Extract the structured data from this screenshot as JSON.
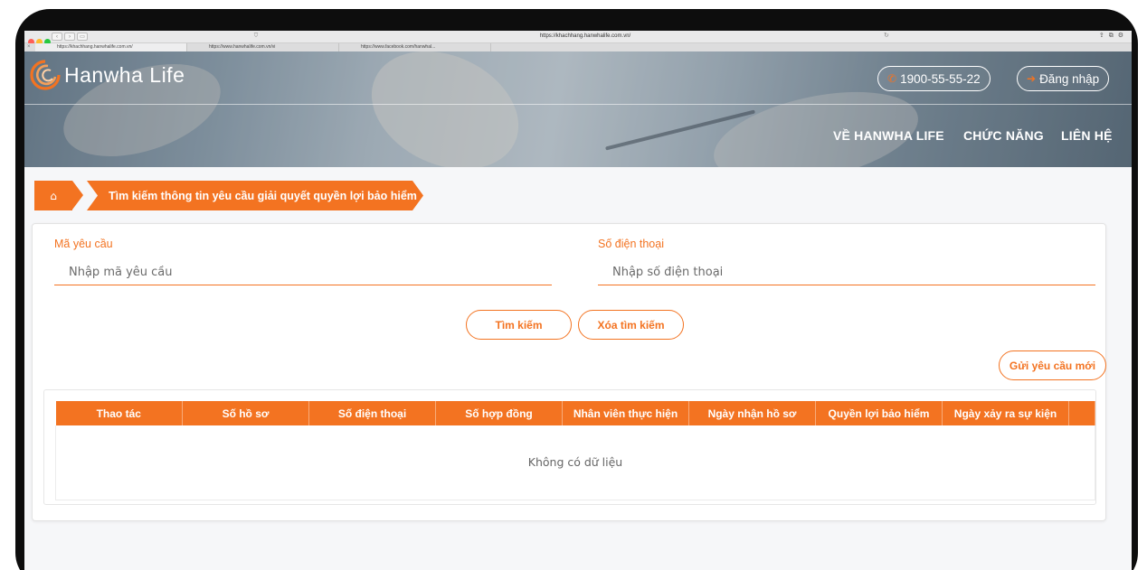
{
  "browser": {
    "address": "https://khachhang.hanwhalife.com.vn/",
    "tabs": [
      {
        "label": "https://khachhang.hanwhalife.com.vn/"
      },
      {
        "label": "https://www.hanwhalife.com.vn/vi"
      },
      {
        "label": "https://www.facebook.com/hanwhal..."
      }
    ]
  },
  "header": {
    "logo_text": "Hanwha Life",
    "hotline": "1900-55-55-22",
    "login_label": "Đăng nhập",
    "menu": [
      {
        "label": "VỀ HANWHA LIFE"
      },
      {
        "label": "CHỨC NĂNG"
      },
      {
        "label": "LIÊN HỆ"
      }
    ]
  },
  "breadcrumb": {
    "title": "Tìm kiếm thông tin yêu cầu giải quyết quyền lợi bảo hiểm"
  },
  "search": {
    "request_code_label": "Mã yêu cầu",
    "request_code_placeholder": "Nhập mã yêu cầu",
    "phone_label": "Số điện thoại",
    "phone_placeholder": "Nhập số điện thoại",
    "search_button": "Tìm kiếm",
    "clear_button": "Xóa tìm kiếm",
    "new_request_button": "Gửi yêu cầu mới"
  },
  "table": {
    "columns": [
      "Thao tác",
      "Số hồ sơ",
      "Số điện thoại",
      "Số hợp đồng",
      "Nhân viên thực hiện",
      "Ngày nhận hồ sơ",
      "Quyền lợi bảo hiểm",
      "Ngày xảy ra sự kiện"
    ],
    "empty_text": "Không có dữ liệu"
  },
  "colors": {
    "brand_orange": "#f37321",
    "traffic_red": "#ff5f57",
    "traffic_yellow": "#febc2e",
    "traffic_green": "#28c840"
  }
}
